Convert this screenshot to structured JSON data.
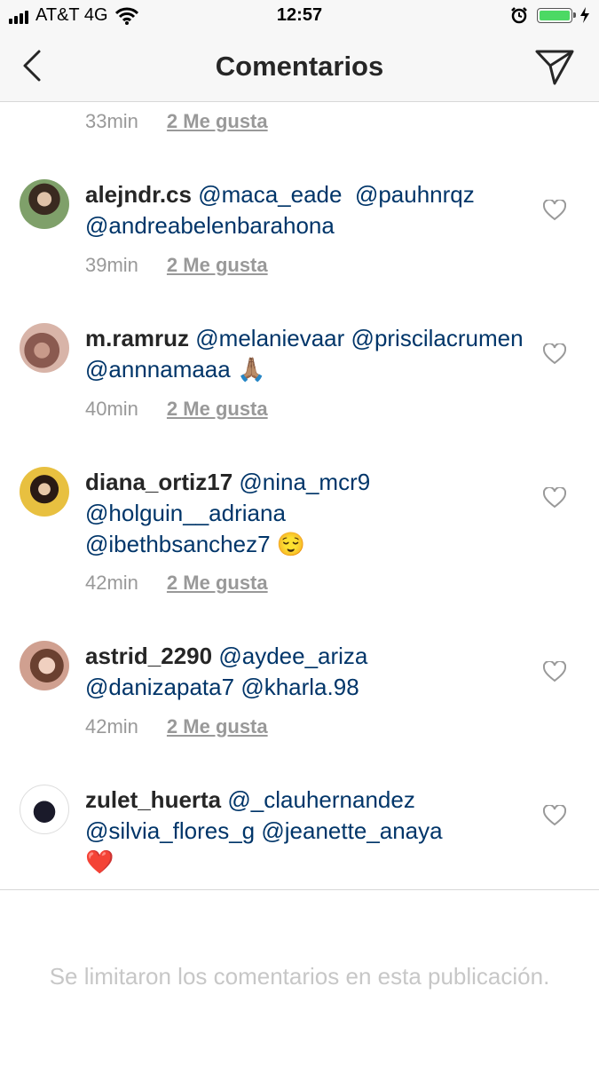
{
  "status_bar": {
    "carrier": "AT&T 4G",
    "time": "12:57"
  },
  "header": {
    "title": "Comentarios"
  },
  "top_meta": {
    "time": "33min",
    "likes": "2 Me gusta"
  },
  "comments": [
    {
      "user": "alejndr.cs",
      "mentions": [
        "@maca_eade",
        "@pauhnrqz",
        "@andreabelenbarahona"
      ],
      "emoji": "",
      "time": "39min",
      "likes": "2 Me gusta"
    },
    {
      "user": "m.ramruz",
      "mentions": [
        "@melanievaar",
        "@priscilacrumen",
        "@annnamaaa"
      ],
      "emoji": "🙏🏽",
      "time": "40min",
      "likes": "2 Me gusta"
    },
    {
      "user": "diana_ortiz17",
      "mentions": [
        "@nina_mcr9",
        "@holguin__adriana",
        "@ibethbsanchez7"
      ],
      "emoji": "😌",
      "time": "42min",
      "likes": "2 Me gusta"
    },
    {
      "user": "astrid_2290",
      "mentions": [
        "@aydee_ariza",
        "@danizapata7",
        "@kharla.98"
      ],
      "emoji": "",
      "time": "42min",
      "likes": "2 Me gusta"
    },
    {
      "user": "zulet_huerta",
      "mentions": [
        "@_clauhernandez",
        "@silvia_flores_g",
        "@jeanette_anaya"
      ],
      "emoji": "❤️"
    }
  ],
  "footer": {
    "notice": "Se limitaron los comentarios en esta publicación."
  },
  "icons": {
    "back": "chevron-left-icon",
    "send": "paper-plane-icon",
    "like": "heart-outline-icon"
  },
  "colors": {
    "mention": "#003569",
    "meta": "#999999",
    "bar_bg": "#f7f7f7",
    "battery": "#4cd964"
  }
}
